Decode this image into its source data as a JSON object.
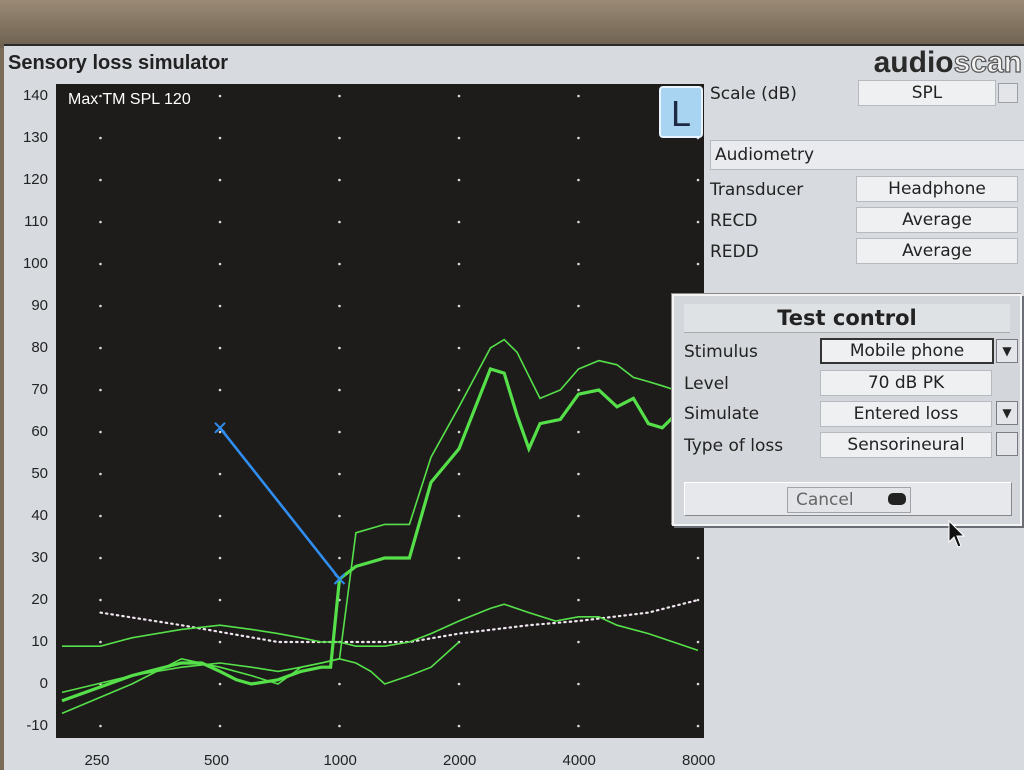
{
  "app": {
    "title": "Sensory loss simulator",
    "brand_dark": "audio",
    "brand_light": "scan"
  },
  "chart_data": {
    "type": "line",
    "title": "Max TM SPL 120",
    "ear_badge": "L",
    "y_ticks": [
      "140",
      "130",
      "120",
      "110",
      "100",
      "90",
      "80",
      "70",
      "60",
      "50",
      "40",
      "30",
      "20",
      "10",
      "0",
      "-10"
    ],
    "ylim": [
      -10,
      140
    ],
    "x_ticks": [
      "250",
      "500",
      "1000",
      "2000",
      "4000",
      "8000"
    ],
    "x_scale": "log",
    "xlim": [
      200,
      8000
    ],
    "grid": "dotted",
    "series": [
      {
        "role": "dotted-white",
        "color": "#f0e6f0",
        "x": [
          250,
          400,
          700,
          1000,
          1500,
          2000,
          3000,
          4000,
          6000,
          8000
        ],
        "y": [
          17,
          14,
          10,
          10,
          10,
          12,
          14,
          15,
          17,
          20
        ]
      },
      {
        "role": "green-thin-upper",
        "color": "#55e04a",
        "x": [
          200,
          300,
          400,
          500,
          600,
          700,
          800,
          900,
          1000,
          1100,
          1300,
          1500,
          1700,
          2000,
          2400,
          2600,
          2800,
          3200,
          3600,
          4000,
          4500,
          5000,
          5500,
          6000,
          6500,
          7000,
          8000
        ],
        "y": [
          -7,
          0,
          6,
          4,
          2,
          0,
          4,
          5,
          6,
          36,
          38,
          38,
          54,
          66,
          80,
          82,
          79,
          68,
          70,
          75,
          77,
          76,
          73,
          72,
          71,
          70,
          71
        ]
      },
      {
        "role": "green-thick-aided",
        "color": "#55e04a",
        "x": [
          200,
          300,
          400,
          450,
          500,
          550,
          600,
          700,
          800,
          900,
          950,
          1000,
          1100,
          1300,
          1500,
          1700,
          2000,
          2400,
          2600,
          2800,
          3000,
          3200,
          3600,
          4000,
          4500,
          5000,
          5500,
          6000,
          6500,
          7000,
          8000
        ],
        "y": [
          -4,
          2,
          5,
          5,
          3,
          1,
          0,
          1,
          3,
          4,
          4,
          25,
          28,
          30,
          30,
          48,
          56,
          75,
          74,
          64,
          56,
          62,
          63,
          69,
          70,
          66,
          68,
          62,
          61,
          64,
          64
        ]
      },
      {
        "role": "green-thin-noise",
        "color": "#55e04a",
        "x": [
          200,
          250,
          300,
          400,
          500,
          600,
          700,
          800,
          900,
          1000,
          1100,
          1300,
          1500,
          1700,
          2000,
          2400,
          2600,
          3000,
          3500,
          4000,
          4500,
          5000,
          6000,
          8000
        ],
        "y": [
          9,
          9,
          11,
          13,
          14,
          13,
          12,
          11,
          10,
          10,
          9,
          9,
          10,
          12,
          15,
          18,
          19,
          17,
          15,
          16,
          16,
          14,
          12,
          8
        ]
      },
      {
        "role": "green-thin-lower",
        "color": "#55e04a",
        "x": [
          200,
          300,
          400,
          500,
          600,
          700,
          800,
          900,
          1000,
          1100,
          1200,
          1300,
          1500,
          1700,
          2000
        ],
        "y": [
          -2,
          2,
          4,
          5,
          4,
          3,
          4,
          5,
          6,
          5,
          3,
          0,
          2,
          4,
          10
        ]
      },
      {
        "role": "blue-entered-loss",
        "color": "#2f8ef0",
        "x": [
          500,
          1000
        ],
        "y": [
          61,
          25
        ],
        "marker": "x"
      }
    ]
  },
  "side_panel": {
    "scale_label": "Scale (dB)",
    "scale_value": "SPL",
    "section": "Audiometry",
    "transducer_label": "Transducer",
    "transducer_value": "Headphone",
    "recd_label": "RECD",
    "recd_value": "Average",
    "redd_label": "REDD",
    "redd_value": "Average"
  },
  "dialog": {
    "title": "Test control",
    "stimulus_label": "Stimulus",
    "stimulus_value": "Mobile phone",
    "level_label": "Level",
    "level_value": "70 dB PK",
    "simulate_label": "Simulate",
    "simulate_value": "Entered loss",
    "type_label": "Type of loss",
    "type_value": "Sensorineural",
    "cancel_label": "Cancel"
  },
  "colors": {
    "plot_bg": "#1e1c1a",
    "curve": "#55e04a",
    "loss_line": "#2f8ef0",
    "grid_dot": "#d8d8d8"
  }
}
